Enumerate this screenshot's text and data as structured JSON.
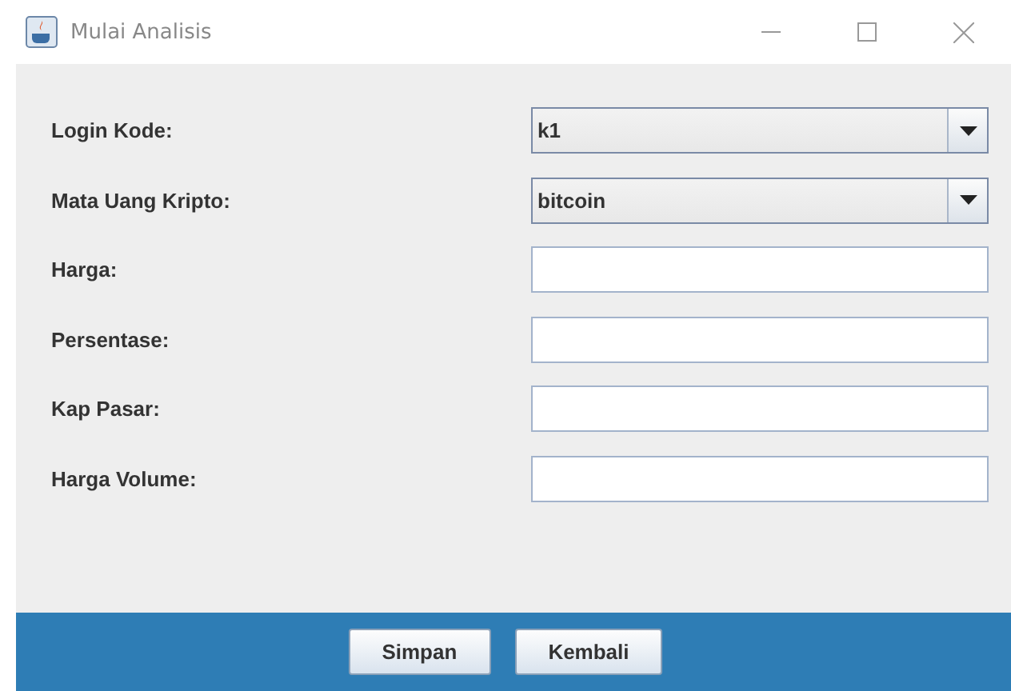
{
  "window": {
    "title": "Mulai Analisis"
  },
  "fields": [
    {
      "label": "Login Kode:",
      "kind": "combo",
      "value": "k1"
    },
    {
      "label": "Mata Uang Kripto:",
      "kind": "combo",
      "value": "bitcoin"
    },
    {
      "label": "Harga:",
      "kind": "text"
    },
    {
      "label": "Persentase:",
      "kind": "text"
    },
    {
      "label": "Kap Pasar:",
      "kind": "text"
    },
    {
      "label": "Harga Volume:",
      "kind": "text"
    }
  ],
  "buttons": [
    "Simpan",
    "Kembali"
  ]
}
